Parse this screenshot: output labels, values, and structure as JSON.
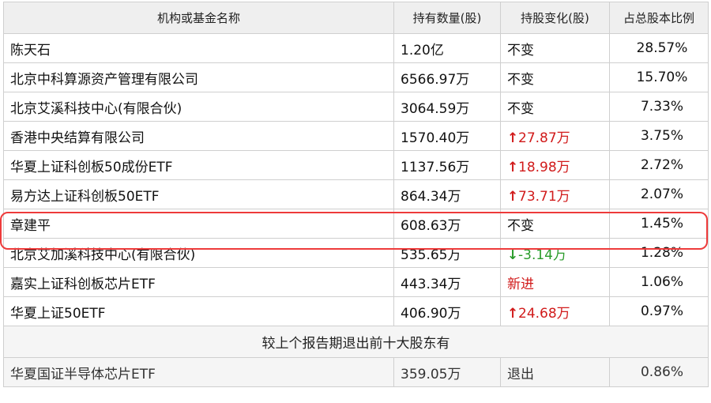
{
  "header": {
    "col_name": "机构或基金名称",
    "col_shares": "持有数量(股)",
    "col_change": "持股变化(股)",
    "col_ratio": "占总股本比例"
  },
  "rows": [
    {
      "name": "陈天石",
      "shares": "1.20亿",
      "change": "不变",
      "direction": "same",
      "ratio": "28.57%"
    },
    {
      "name": "北京中科算源资产管理有限公司",
      "shares": "6566.97万",
      "change": "不变",
      "direction": "same",
      "ratio": "15.70%"
    },
    {
      "name": "北京艾溪科技中心(有限合伙)",
      "shares": "3064.59万",
      "change": "不变",
      "direction": "same",
      "ratio": "7.33%"
    },
    {
      "name": "香港中央结算有限公司",
      "shares": "1570.40万",
      "change": "27.87万",
      "direction": "up",
      "ratio": "3.75%"
    },
    {
      "name": "华夏上证科创板50成份ETF",
      "shares": "1137.56万",
      "change": "18.98万",
      "direction": "up",
      "ratio": "2.72%"
    },
    {
      "name": "易方达上证科创板50ETF",
      "shares": "864.34万",
      "change": "73.71万",
      "direction": "up",
      "ratio": "2.07%"
    },
    {
      "name": "章建平",
      "shares": "608.63万",
      "change": "不变",
      "direction": "same",
      "ratio": "1.45%"
    },
    {
      "name": "北京艾加溪科技中心(有限合伙)",
      "shares": "535.65万",
      "change": "-3.14万",
      "direction": "down",
      "ratio": "1.28%"
    },
    {
      "name": "嘉实上证科创板芯片ETF",
      "shares": "443.34万",
      "change": "新进",
      "direction": "new",
      "ratio": "1.06%"
    },
    {
      "name": "华夏上证50ETF",
      "shares": "406.90万",
      "change": "24.68万",
      "direction": "up",
      "ratio": "0.97%"
    }
  ],
  "section_title": "较上个报告期退出前十大股东有",
  "exited": [
    {
      "name": "华夏国证半导体芯片ETF",
      "shares": "359.05万",
      "change": "退出",
      "ratio": "0.86%"
    }
  ],
  "highlighted_holder": "章建平",
  "colors": {
    "up": "#d11b1b",
    "down": "#2a9b2a",
    "highlight_border": "#ee3b3b",
    "header_bg": "#efefef"
  },
  "icons": {
    "up": "arrow-up-icon",
    "down": "arrow-down-icon"
  }
}
